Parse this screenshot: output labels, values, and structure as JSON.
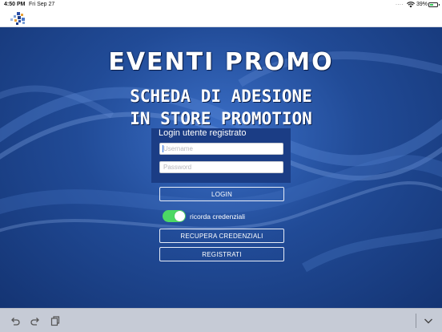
{
  "status_bar": {
    "time": "4:50 PM",
    "date": "Fri Sep 27",
    "dots": "....",
    "battery_percent": "39%",
    "battery_level": 0.39
  },
  "hero": {
    "title": "EVENTI  PROMO",
    "subtitle_line1": "SCHEDA DI ADESIONE",
    "subtitle_line2": "IN STORE PROMOTION"
  },
  "login": {
    "heading": "Login utente registrato",
    "username_placeholder": "Username",
    "password_placeholder": "Password",
    "username_value": "",
    "password_value": "",
    "login_label": "LOGIN",
    "remember_label": "ricorda credenziali",
    "remember_on": true,
    "recover_label": "RECUPERA CREDENZIALI",
    "register_label": "REGISTRATI"
  },
  "toolbar": {
    "icons": [
      "undo-icon",
      "redo-icon",
      "paste-icon",
      "chevron-down-icon"
    ]
  },
  "colors": {
    "accent_green": "#4cd964",
    "background_blue": "#214b97",
    "toolbar_gray": "#c6cbd6"
  }
}
